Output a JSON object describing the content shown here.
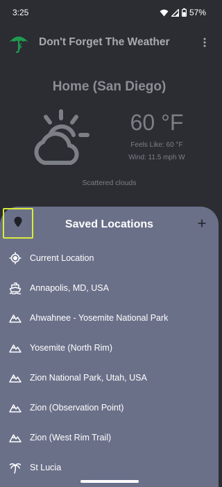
{
  "status_bar": {
    "time": "3:25",
    "battery": "57%"
  },
  "app_bar": {
    "title": "Don't Forget The Weather",
    "logo_icon": "umbrella-bolt-icon",
    "menu_icon": "more-vert-icon"
  },
  "weather": {
    "location": "Home (San Diego)",
    "icon": "partly-cloudy-icon",
    "temperature": "60 °F",
    "feels_like": "Feels Like: 60 °F",
    "wind": "Wind: 11.5 mph W",
    "condition": "Scattered clouds"
  },
  "sheet": {
    "title": "Saved Locations",
    "pin_icon": "location-pin-icon",
    "add_icon": "plus-icon",
    "locations": [
      {
        "label": "Current Location",
        "icon": "my-location-icon"
      },
      {
        "label": "Annapolis, MD, USA",
        "icon": "boat-icon"
      },
      {
        "label": "Ahwahnee - Yosemite National Park",
        "icon": "mountain-icon"
      },
      {
        "label": "Yosemite (North Rim)",
        "icon": "mountain-icon"
      },
      {
        "label": "Zion National Park, Utah, USA",
        "icon": "mountain-icon"
      },
      {
        "label": "Zion (Observation Point)",
        "icon": "mountain-icon"
      },
      {
        "label": "Zion (West Rim Trail)",
        "icon": "mountain-icon"
      },
      {
        "label": "St Lucia",
        "icon": "palm-tree-icon"
      }
    ]
  },
  "colors": {
    "background": "#2b2d33",
    "sheet": "#6b7089",
    "logo_green": "#1f9b4f",
    "focus_outline": "#d9ec3a"
  }
}
